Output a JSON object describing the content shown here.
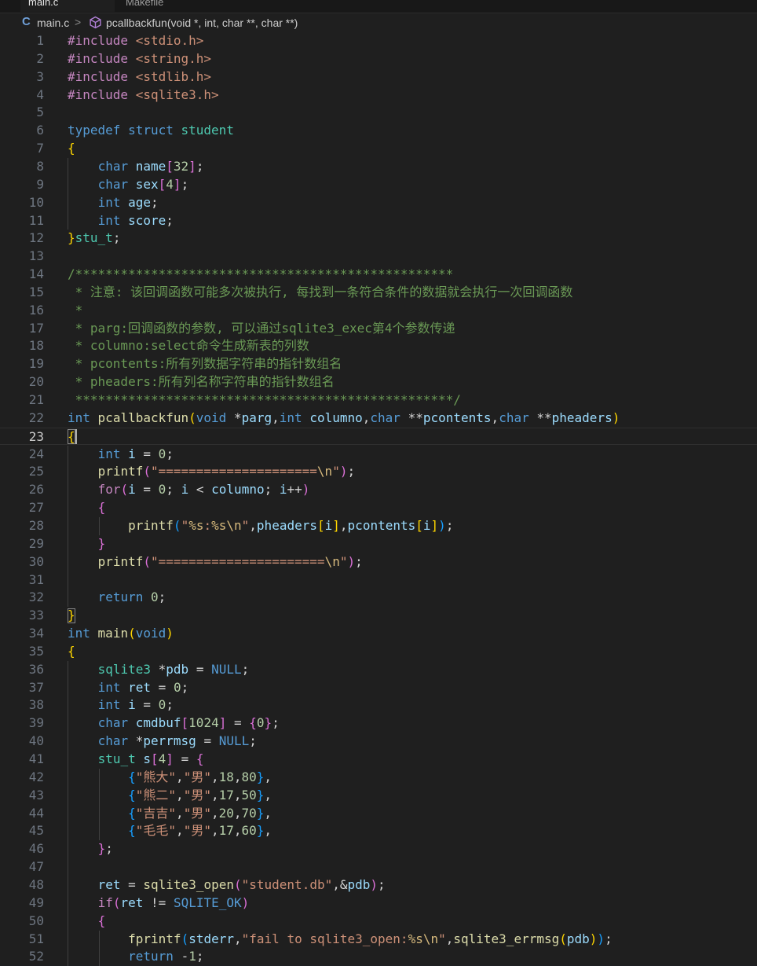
{
  "tabs": [
    {
      "label": "main.c",
      "active": true
    },
    {
      "label": "Makefile",
      "active": false
    }
  ],
  "breadcrumb": {
    "lang_icon": "C",
    "file": "main.c",
    "separator": ">",
    "symbol_icon": "symbol-method-icon",
    "symbol": "pcallbackfun(void *, int, char **, char **)"
  },
  "editor": {
    "current_line": 23,
    "lines": [
      "#include <stdio.h>",
      "#include <string.h>",
      "#include <stdlib.h>",
      "#include <sqlite3.h>",
      "",
      "typedef struct student",
      "{",
      "    char name[32];",
      "    char sex[4];",
      "    int age;",
      "    int score;",
      "}stu_t;",
      "",
      "/**************************************************",
      " * 注意: 该回调函数可能多次被执行, 每找到一条符合条件的数据就会执行一次回调函数",
      " *",
      " * parg:回调函数的参数, 可以通过sqlite3_exec第4个参数传递",
      " * columno:select命令生成新表的列数",
      " * pcontents:所有列数据字符串的指针数组名",
      " * pheaders:所有列名称字符串的指针数组名",
      " **************************************************/",
      "int pcallbackfun(void *parg,int columno,char **pcontents,char **pheaders)",
      "{",
      "    int i = 0;",
      "    printf(\"=====================\\n\");",
      "    for(i = 0; i < columno; i++)",
      "    {",
      "        printf(\"%s:%s\\n\",pheaders[i],pcontents[i]);",
      "    }",
      "    printf(\"======================\\n\");",
      "",
      "    return 0;",
      "}",
      "int main(void)",
      "{",
      "    sqlite3 *pdb = NULL;",
      "    int ret = 0;",
      "    int i = 0;",
      "    char cmdbuf[1024] = {0};",
      "    char *perrmsg = NULL;",
      "    stu_t s[4] = {",
      "        {\"熊大\",\"男\",18,80},",
      "        {\"熊二\",\"男\",17,50},",
      "        {\"吉吉\",\"男\",20,70},",
      "        {\"毛毛\",\"男\",17,60},",
      "    };",
      "",
      "    ret = sqlite3_open(\"student.db\",&pdb);",
      "    if(ret != SQLITE_OK)",
      "    {",
      "        fprintf(stderr,\"fail to sqlite3_open:%s\\n\",sqlite3_errmsg(pdb));",
      "        return -1;"
    ]
  },
  "colors": {
    "background": "#1f1f1f",
    "preprocessor": "#c586c0",
    "keyword": "#569cd6",
    "control": "#c586c0",
    "type": "#4ec9b0",
    "function": "#dcdcaa",
    "variable": "#9cdcfe",
    "string": "#ce9178",
    "number": "#b5cea8",
    "comment": "#6a9955",
    "bracket1": "#ffd700",
    "bracket2": "#da70d6",
    "bracket3": "#179fff"
  }
}
